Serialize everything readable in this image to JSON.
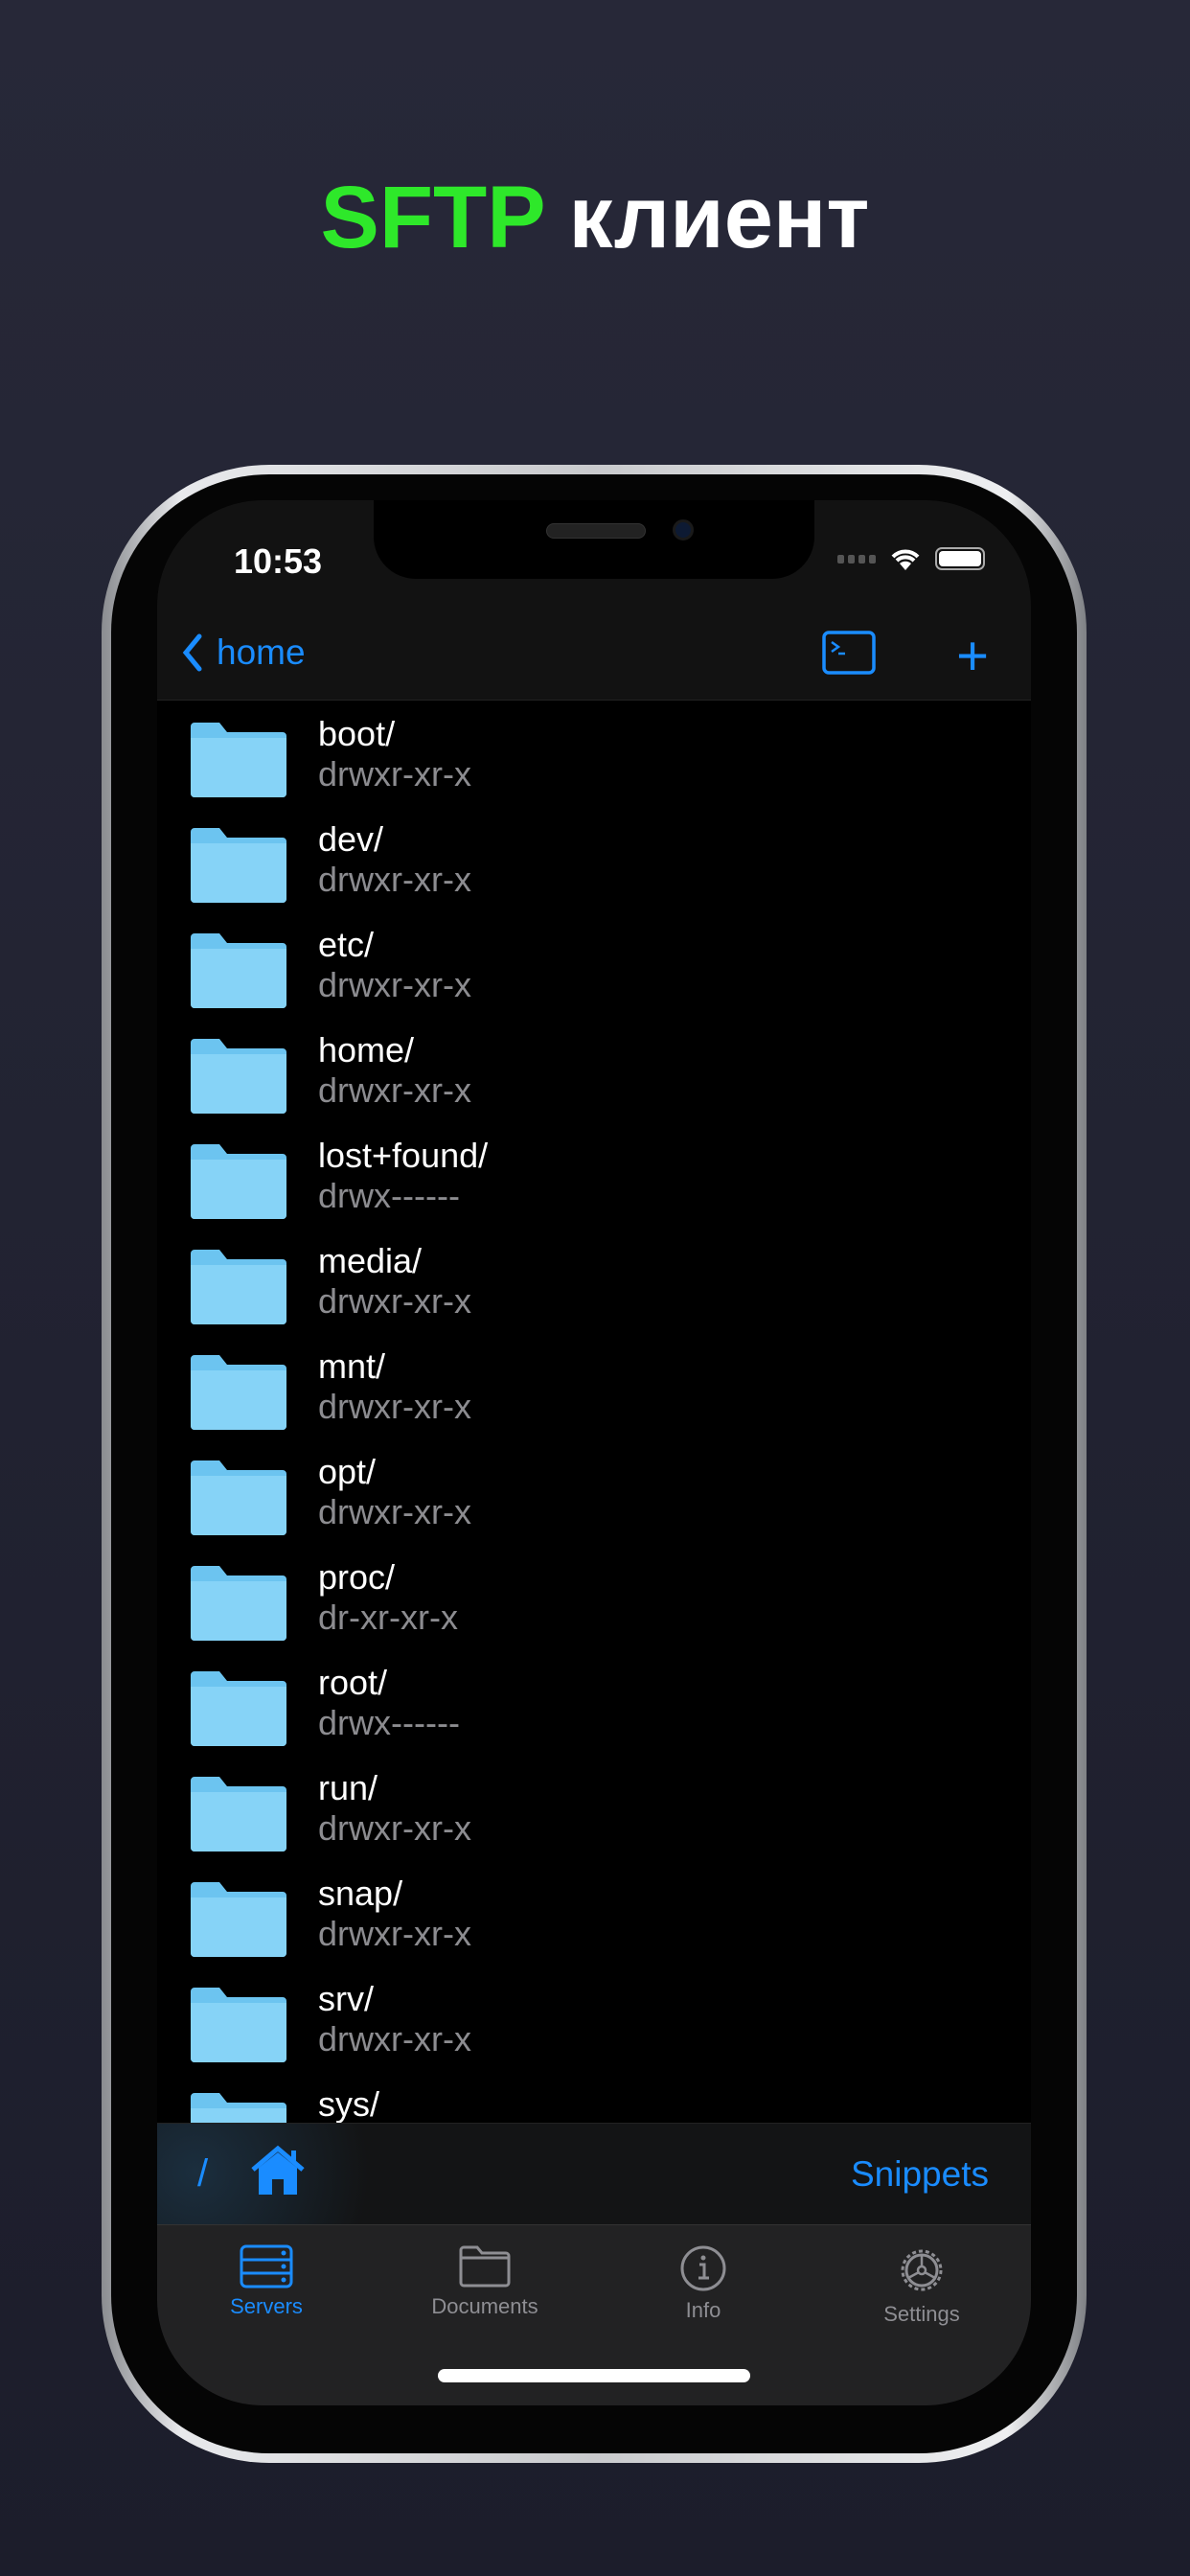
{
  "headline": {
    "accent": "SFTP",
    "rest": " клиент"
  },
  "colors": {
    "accent_green": "#2ee82a",
    "ios_blue": "#1a8cff",
    "folder": "#7ccdf5"
  },
  "status_bar": {
    "time": "10:53"
  },
  "nav": {
    "back_label": "home",
    "terminal_icon": "terminal-icon",
    "add_icon": "plus-icon"
  },
  "files": [
    {
      "name": "boot/",
      "perm": "drwxr-xr-x"
    },
    {
      "name": "dev/",
      "perm": "drwxr-xr-x"
    },
    {
      "name": "etc/",
      "perm": "drwxr-xr-x"
    },
    {
      "name": "home/",
      "perm": "drwxr-xr-x"
    },
    {
      "name": "lost+found/",
      "perm": "drwx------"
    },
    {
      "name": "media/",
      "perm": "drwxr-xr-x"
    },
    {
      "name": "mnt/",
      "perm": "drwxr-xr-x"
    },
    {
      "name": "opt/",
      "perm": "drwxr-xr-x"
    },
    {
      "name": "proc/",
      "perm": "dr-xr-xr-x"
    },
    {
      "name": "root/",
      "perm": "drwx------"
    },
    {
      "name": "run/",
      "perm": "drwxr-xr-x"
    },
    {
      "name": "snap/",
      "perm": "drwxr-xr-x"
    },
    {
      "name": "srv/",
      "perm": "drwxr-xr-x"
    },
    {
      "name": "sys/",
      "perm": ""
    }
  ],
  "toolbar": {
    "root_label": "/",
    "snippets_label": "Snippets"
  },
  "tabs": [
    {
      "label": "Servers",
      "icon": "servers-icon",
      "active": true
    },
    {
      "label": "Documents",
      "icon": "folder-icon",
      "active": false
    },
    {
      "label": "Info",
      "icon": "info-icon",
      "active": false
    },
    {
      "label": "Settings",
      "icon": "gear-icon",
      "active": false
    }
  ]
}
